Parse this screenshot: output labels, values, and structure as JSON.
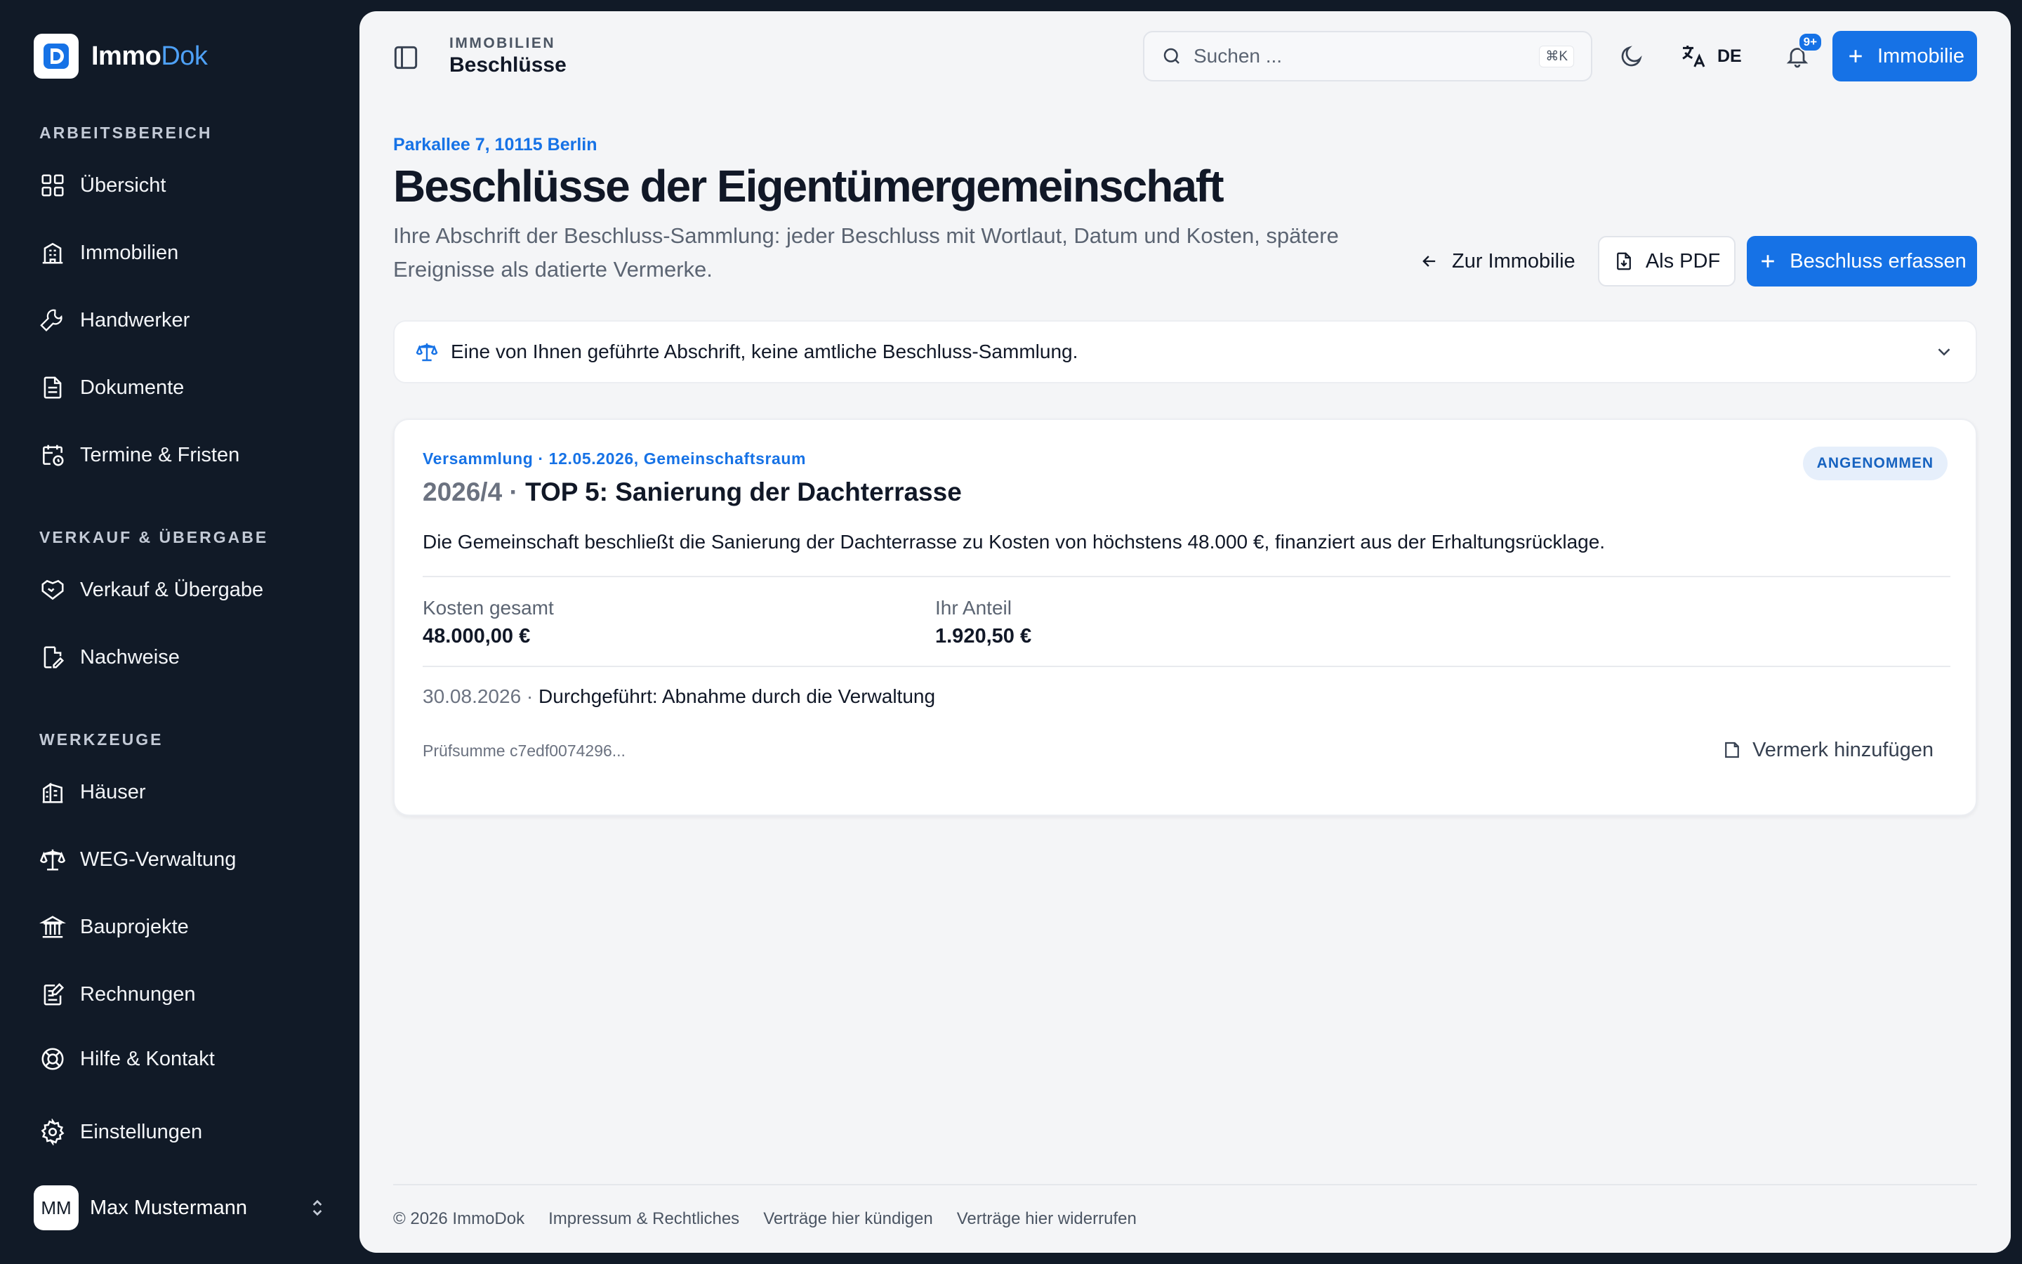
{
  "brand": {
    "name_part1": "Immo",
    "name_part2": "Dok"
  },
  "sidebar": {
    "sections": [
      {
        "label": "ARBEITSBEREICH"
      },
      {
        "label": "VERKAUF & ÜBERGABE"
      },
      {
        "label": "WERKZEUGE"
      }
    ],
    "items": [
      {
        "label": "Übersicht",
        "icon": "grid-icon"
      },
      {
        "label": "Immobilien",
        "icon": "building-icon"
      },
      {
        "label": "Handwerker",
        "icon": "wrench-icon"
      },
      {
        "label": "Dokumente",
        "icon": "document-icon"
      },
      {
        "label": "Termine & Fristen",
        "icon": "calendar-clock-icon"
      },
      {
        "label": "Verkauf & Übergabe",
        "icon": "handshake-icon"
      },
      {
        "label": "Nachweise",
        "icon": "file-edit-icon"
      },
      {
        "label": "Häuser",
        "icon": "buildings-icon"
      },
      {
        "label": "WEG-Verwaltung",
        "icon": "scale-icon"
      },
      {
        "label": "Bauprojekte",
        "icon": "landmark-icon"
      },
      {
        "label": "Rechnungen",
        "icon": "receipt-edit-icon"
      },
      {
        "label": "Hilfe & Kontakt",
        "icon": "lifebuoy-icon"
      },
      {
        "label": "Einstellungen",
        "icon": "gear-icon"
      }
    ],
    "user": {
      "initials": "MM",
      "name": "Max Mustermann"
    }
  },
  "topbar": {
    "overline": "IMMOBILIEN",
    "title": "Beschlüsse",
    "search_placeholder": "Suchen ...",
    "search_shortcut": "⌘K",
    "language": "DE",
    "notifications_badge": "9+",
    "add_button": "Immobilie"
  },
  "page": {
    "address": "Parkallee 7, 10115 Berlin",
    "title": "Beschlüsse der Eigentümergemeinschaft",
    "subtitle": "Ihre Abschrift der Beschluss-Sammlung: jeder Beschluss mit Wortlaut, Datum und Kosten, spätere Ereignisse als datierte Vermerke.",
    "back_button": "Zur Immobilie",
    "pdf_button": "Als PDF",
    "new_button": "Beschluss erfassen",
    "notice": "Eine von Ihnen geführte Abschrift, keine amtliche Beschluss-Sammlung."
  },
  "resolution": {
    "meta": "Versammlung · 12.05.2026, Gemeinschaftsraum",
    "number": "2026/4 · ",
    "title": "TOP 5: Sanierung der Dachterrasse",
    "status": "ANGENOMMEN",
    "text": "Die Gemeinschaft beschließt die Sanierung der Dachterrasse zu Kosten von höchstens 48.000 €, finanziert aus der Erhaltungsrücklage.",
    "cost_label": "Kosten gesamt",
    "cost_value": "48.000,00 €",
    "share_label": "Ihr Anteil",
    "share_value": "1.920,50 €",
    "event_date": "30.08.2026 · ",
    "event_text": "Durchgeführt: Abnahme durch die Verwaltung",
    "checksum": "Prüfsumme c7edf0074296...",
    "add_note": "Vermerk hinzufügen"
  },
  "footer": {
    "links": [
      "© 2026 ImmoDok",
      "Impressum & Rechtliches",
      "Verträge hier kündigen",
      "Verträge hier widerrufen"
    ]
  },
  "colors": {
    "accent": "#1672e6",
    "sidebar_bg": "#111a27",
    "content_bg": "#f4f5f7"
  }
}
